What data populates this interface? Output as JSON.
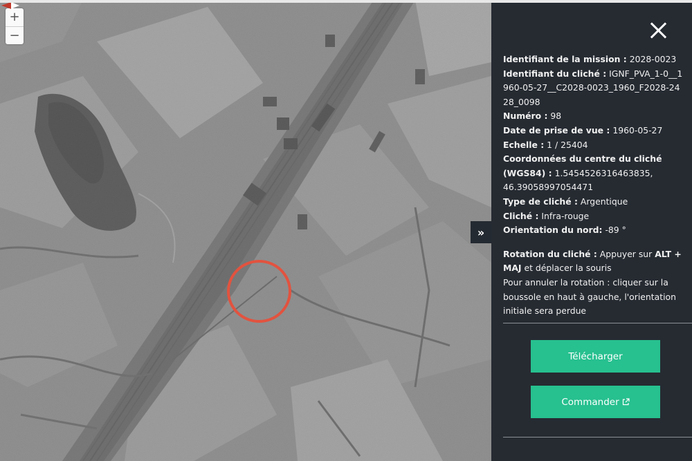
{
  "map": {
    "zoom_in": "+",
    "zoom_out": "−",
    "icons": {
      "compass": "compass-icon",
      "toggle": "double-chevron-right-icon"
    },
    "toggle_label": "»",
    "marker_color": "#e2533f"
  },
  "panel": {
    "fields": [
      {
        "label": "Identifiant de la mission :",
        "value": "2028-0023"
      },
      {
        "label": "Identifiant du cliché :",
        "value": "IGNF_PVA_1-0__1960-05-27__C2028-0023_1960_F2028-2428_0098"
      },
      {
        "label": "Numéro :",
        "value": "98"
      },
      {
        "label": "Date de prise de vue :",
        "value": "1960-05-27"
      },
      {
        "label": "Echelle :",
        "value": "1 / 25404"
      },
      {
        "label": "Coordonnées du centre du cliché (WGS84) :",
        "value": "1.5454526316463835, 46.39058997054471"
      },
      {
        "label": "Type de cliché :",
        "value": "Argentique"
      },
      {
        "label": "Cliché :",
        "value": "Infra-rouge"
      },
      {
        "label": "Orientation du nord:",
        "value": "-89 °"
      }
    ],
    "rotation": {
      "label": "Rotation du cliché :",
      "text1": "Appuyer sur",
      "key1": "ALT + MAJ",
      "text2": "et déplacer la souris",
      "cancel_text": "Pour annuler la rotation : cliquer sur la boussole en haut à gauche, l'orientation initiale sera perdue"
    },
    "download_label": "Télécharger",
    "order_label": "Commander",
    "colors": {
      "panel_bg": "#262b32",
      "button": "#27c08f"
    }
  }
}
